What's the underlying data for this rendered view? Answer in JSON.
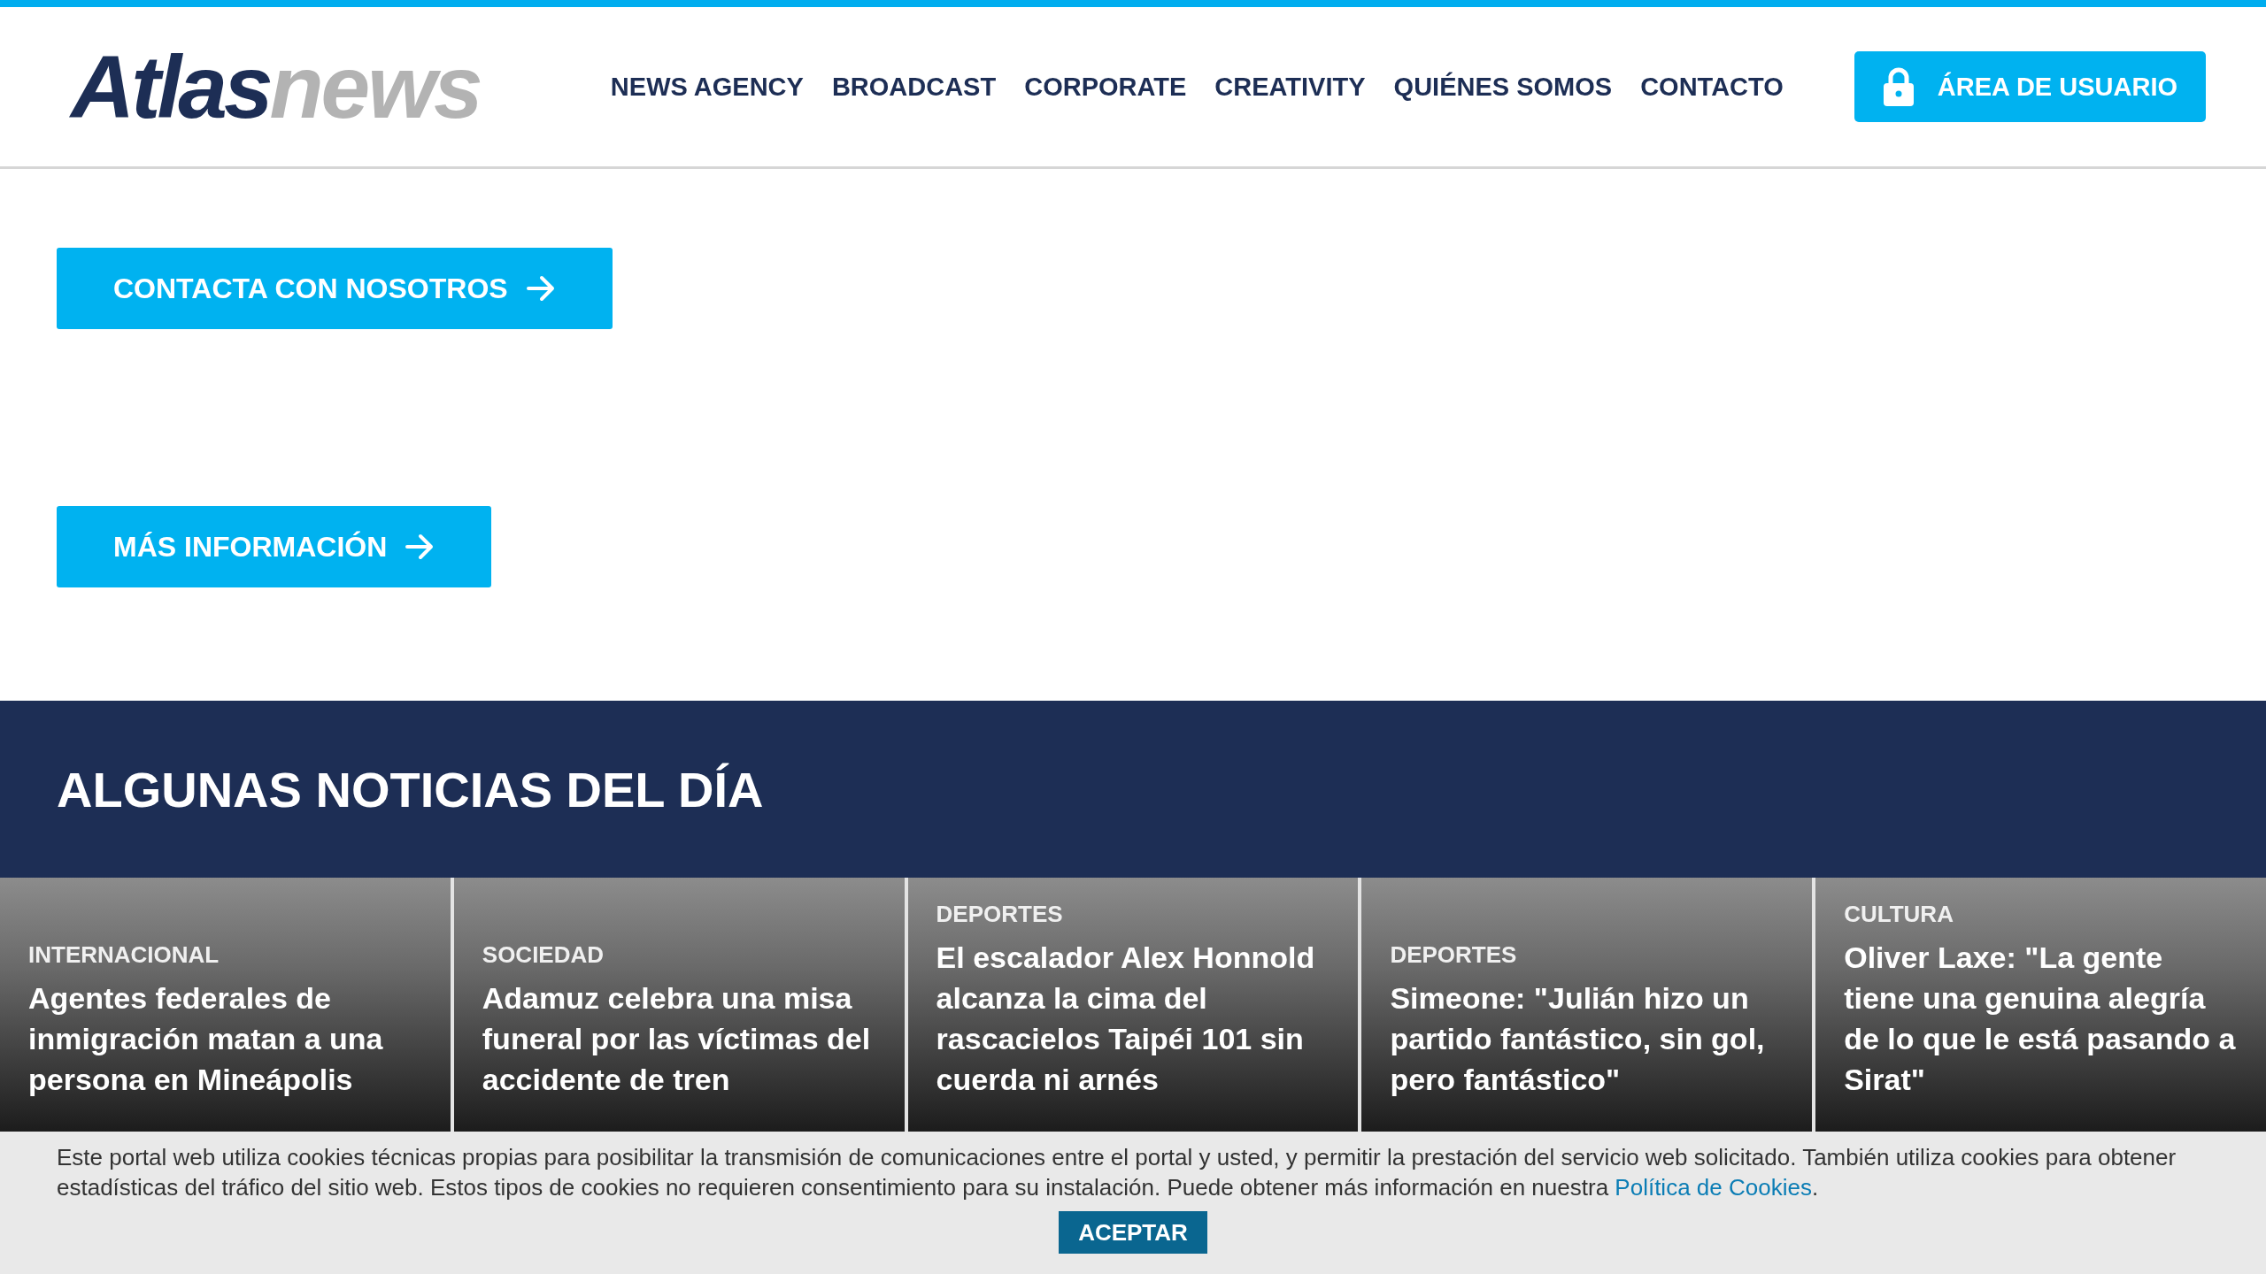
{
  "header": {
    "logo": {
      "brand": "Atlas",
      "suffix": "news"
    },
    "nav": [
      {
        "label": "NEWS AGENCY"
      },
      {
        "label": "BROADCAST"
      },
      {
        "label": "CORPORATE"
      },
      {
        "label": "CREATIVITY"
      },
      {
        "label": "QUIÉNES SOMOS"
      },
      {
        "label": "CONTACTO"
      }
    ],
    "user_button": "ÁREA DE USUARIO"
  },
  "buttons": [
    {
      "label": "CONTACTA CON NOSOTROS"
    },
    {
      "label": "MÁS INFORMACIÓN"
    }
  ],
  "news_section": {
    "title": "ALGUNAS NOTICIAS DEL DÍA",
    "cards": [
      {
        "category": "INTERNACIONAL",
        "headline": "Agentes federales de inmigración matan a una persona en Mineápolis"
      },
      {
        "category": "SOCIEDAD",
        "headline": "Adamuz celebra una misa funeral por las víctimas del accidente de tren"
      },
      {
        "category": "DEPORTES",
        "headline": "El escalador Alex Honnold alcanza la cima del rascacielos Taipéi 101 sin cuerda ni arnés"
      },
      {
        "category": "DEPORTES",
        "headline": "Simeone: \"Julián hizo un partido fantástico, sin gol, pero fantástico\""
      },
      {
        "category": "CULTURA",
        "headline": "Oliver Laxe: \"La gente tiene una genuina alegría de lo que le está pasando a Sirat\""
      }
    ]
  },
  "cookie_banner": {
    "text": "Este portal web utiliza cookies técnicas propias para posibilitar la transmisión de comunicaciones entre el portal y usted, y permitir la prestación del servicio web solicitado. También utiliza cookies para obtener estadísticas del tráfico del sitio web. Estos tipos de cookies no requieren consentimiento para su instalación. Puede obtener más información en nuestra",
    "link": "Política de Cookies",
    "after": ".",
    "button": "ACEPTAR"
  }
}
